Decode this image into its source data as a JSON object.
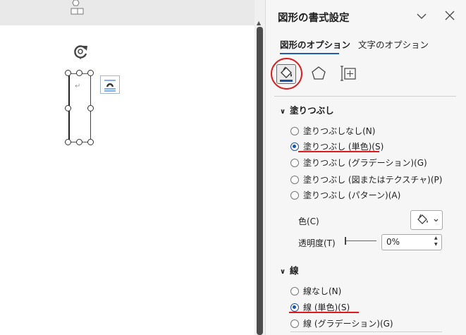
{
  "pane": {
    "title": "図形の書式設定",
    "tabs": [
      {
        "label": "図形のオプション",
        "selected": true
      },
      {
        "label": "文字のオプション",
        "selected": false
      }
    ],
    "categories": [
      {
        "icon": "fill-line-icon",
        "selected": true
      },
      {
        "icon": "effects-pentagon-icon",
        "selected": false
      },
      {
        "icon": "size-properties-icon",
        "selected": false
      }
    ]
  },
  "fill": {
    "heading": "塗りつぶし",
    "options": [
      {
        "label": "塗りつぶしなし(N)",
        "selected": false
      },
      {
        "label": "塗りつぶし (単色)(S)",
        "selected": true
      },
      {
        "label": "塗りつぶし (グラデーション)(G)",
        "selected": false
      },
      {
        "label": "塗りつぶし (図またはテクスチャ)(P)",
        "selected": false
      },
      {
        "label": "塗りつぶし (パターン)(A)",
        "selected": false
      }
    ],
    "color_label": "色(C)",
    "transparency_label": "透明度(T)",
    "transparency_value": "0%"
  },
  "line": {
    "heading": "線",
    "options": [
      {
        "label": "線なし(N)",
        "selected": false
      },
      {
        "label": "線 (単色)(S)",
        "selected": true
      },
      {
        "label": "線 (グラデーション)(G)",
        "selected": false
      }
    ]
  },
  "colors": {
    "accent": "#1a56a8",
    "highlight": "#e01b1b"
  }
}
